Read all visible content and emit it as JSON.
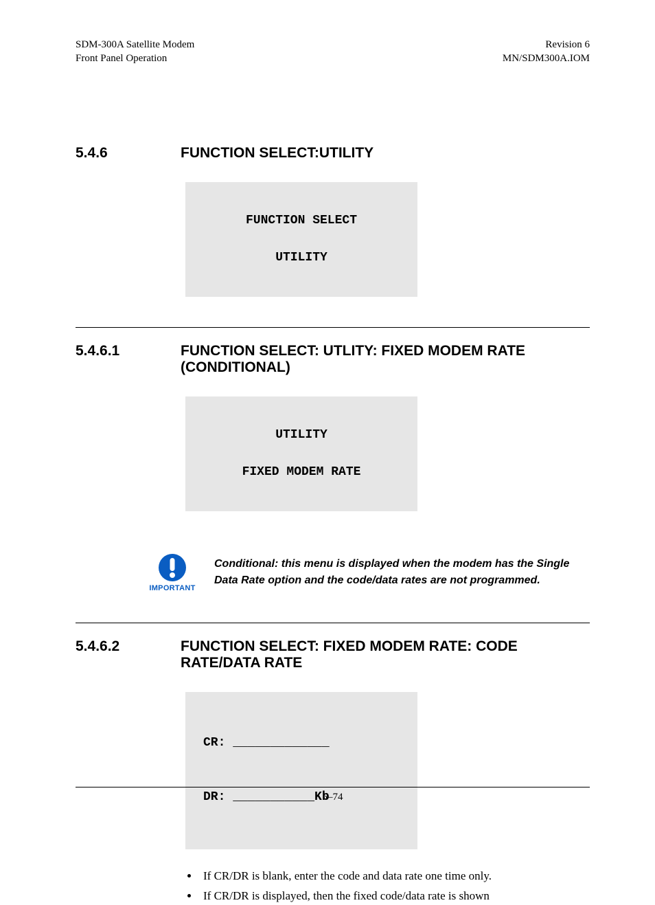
{
  "header": {
    "left1": "SDM-300A Satellite Modem",
    "left2": "Front Panel Operation",
    "right1": "Revision 6",
    "right2": "MN/SDM300A.IOM"
  },
  "s546": {
    "num": "5.4.6",
    "title": "FUNCTION SELECT:UTILITY",
    "lcd1": "FUNCTION SELECT",
    "lcd2": "UTILITY"
  },
  "s5461": {
    "num": "5.4.6.1",
    "title": "FUNCTION SELECT: UTLITY: FIXED MODEM RATE (CONDITIONAL)",
    "lcd1": "UTILITY",
    "lcd2": "FIXED MODEM RATE"
  },
  "important": {
    "label": "IMPORTANT",
    "text": "Conditional: this menu is displayed when the modem has the Single Data Rate option and the code/data rates are not programmed."
  },
  "s5462": {
    "num": "5.4.6.2",
    "title": "FUNCTION SELECT: FIXED MODEM RATE: CODE RATE/DATA RATE",
    "lcd1": "CR: _____________",
    "lcd2": "DR: ___________Kb"
  },
  "bullets": {
    "b1": "If CR/DR is blank, enter the code and data rate one time only.",
    "b2": "If CR/DR is displayed, then the fixed code/data rate is shown"
  },
  "footer": {
    "page": "5–74"
  }
}
